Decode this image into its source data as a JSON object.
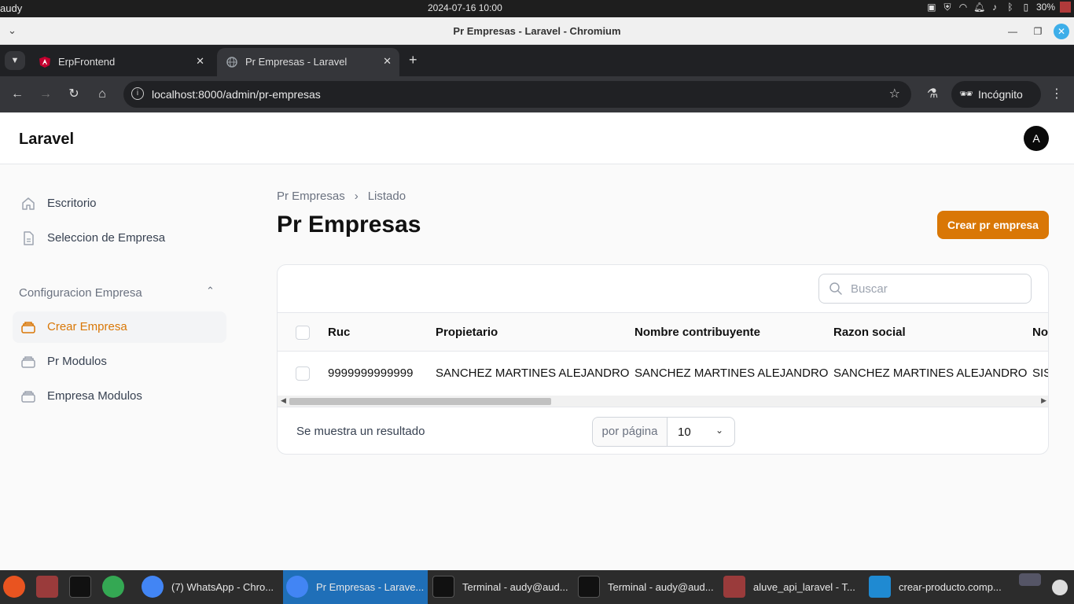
{
  "system": {
    "user": "audy",
    "datetime": "2024-07-16   10:00",
    "battery": "30%"
  },
  "window": {
    "title": "Pr Empresas - Laravel - Chromium"
  },
  "browser": {
    "tabs": [
      {
        "label": "ErpFrontend"
      },
      {
        "label": "Pr Empresas - Laravel"
      }
    ],
    "url": "localhost:8000/admin/pr-empresas",
    "incognito_label": "Incógnito"
  },
  "app": {
    "brand": "Laravel",
    "avatar_initial": "A",
    "accent_color": "#d97706"
  },
  "sidebar": {
    "items": [
      {
        "label": "Escritorio",
        "icon": "home-icon"
      },
      {
        "label": "Seleccion de Empresa",
        "icon": "document-icon"
      }
    ],
    "group": {
      "label": "Configuracion Empresa",
      "items": [
        {
          "label": "Crear Empresa",
          "icon": "stack-icon",
          "active": true
        },
        {
          "label": "Pr Modulos",
          "icon": "stack-icon"
        },
        {
          "label": "Empresa Modulos",
          "icon": "stack-icon"
        }
      ]
    }
  },
  "page": {
    "breadcrumb": [
      "Pr Empresas",
      "Listado"
    ],
    "title": "Pr Empresas",
    "create_button": "Crear pr empresa"
  },
  "table": {
    "search_placeholder": "Buscar",
    "columns": [
      "Ruc",
      "Propietario",
      "Nombre contribuyente",
      "Razon social",
      "Nor"
    ],
    "rows": [
      [
        "9999999999999",
        "SANCHEZ MARTINES ALEJANDRO",
        "SANCHEZ MARTINES ALEJANDRO",
        "SANCHEZ MARTINES ALEJANDRO",
        "SIS"
      ]
    ],
    "result_text": "Se muestra un resultado",
    "per_page_label": "por página",
    "per_page_value": "10"
  },
  "taskbar": {
    "items": [
      {
        "label": "(7) WhatsApp - Chro..."
      },
      {
        "label": "Pr Empresas - Larave..."
      },
      {
        "label": "Terminal - audy@aud..."
      },
      {
        "label": "Terminal - audy@aud..."
      },
      {
        "label": "aluve_api_laravel - T..."
      },
      {
        "label": "crear-producto.comp..."
      }
    ]
  }
}
